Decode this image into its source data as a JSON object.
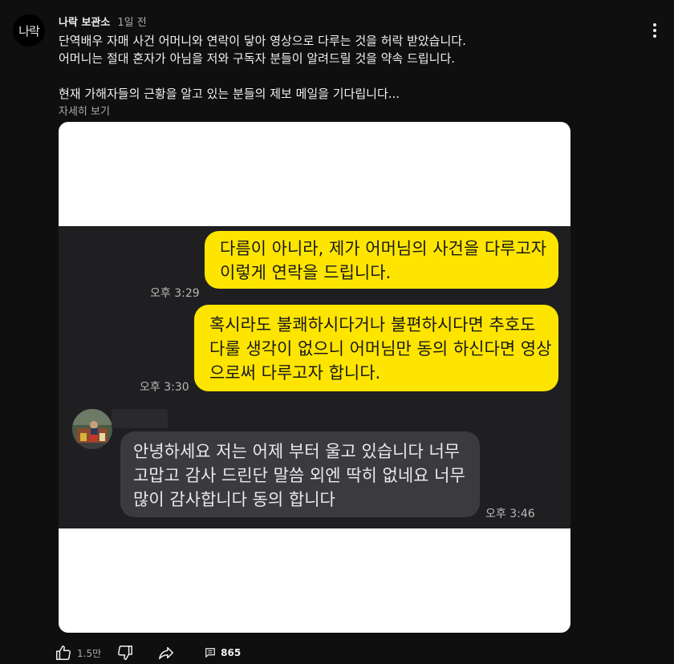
{
  "post": {
    "channel_name": "나락 보관소",
    "time": "1일 전",
    "avatar_text": "나락",
    "text_lines": [
      "단역배우 자매 사건 어머니와 연락이 닿아 영상으로 다루는 것을 허락 받았습니다.",
      "어머니는 절대 혼자가 아님을 저와 구독자 분들이 알려드릴 것을 약속 드립니다.",
      "",
      "현재 가해자들의 근황을 알고 있는 분들의 제보 메일을 기다립니다..."
    ],
    "read_more": "자세히 보기"
  },
  "chat": {
    "messages": [
      {
        "lines": [
          "다름이 아니라, 제가 어머님의 사건을 다루고자",
          "이렇게 연락을 드립니다."
        ],
        "time": "오후 3:29"
      },
      {
        "lines": [
          "혹시라도 불쾌하시다거나 불편하시다면 추호도",
          "다룰 생각이 없으니 어머님만 동의 하신다면 영상",
          "으로써 다루고자 합니다."
        ],
        "time": "오후 3:30"
      },
      {
        "lines": [
          "안녕하세요 저는 어제 부터 울고 있습니다 너무",
          "고맙고 감사 드린단 말씀 외엔 딱히 없네요 너무",
          "많이 감사합니다 동의 합니다"
        ],
        "time": "오후 3:46"
      }
    ],
    "colors": {
      "mine": "#fee500",
      "theirs": "#3b3b3f",
      "background": "#1f1f22"
    }
  },
  "actions": {
    "like_count": "1.5만",
    "comment_count": "865",
    "icons": [
      "thumb-up-icon",
      "thumb-down-icon",
      "share-icon",
      "comment-icon",
      "more-vert-icon"
    ]
  }
}
